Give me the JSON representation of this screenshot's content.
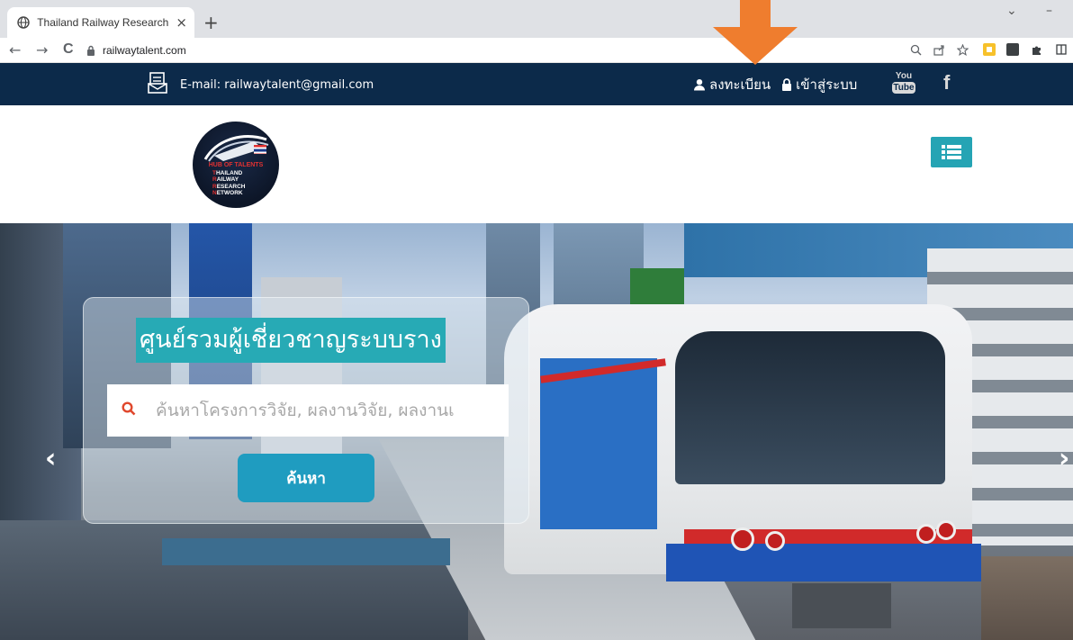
{
  "browser": {
    "tab_title": "Thailand Railway Research Netw",
    "tab_close": "×",
    "new_tab": "+",
    "url": "railwaytalent.com",
    "nav": {
      "back": "←",
      "forward": "→",
      "reload": "C"
    },
    "window": {
      "chevron": "⌄",
      "minimize": "–"
    },
    "accent": "#f7c12b"
  },
  "topbar": {
    "email": "E-mail: railwaytalent@gmail.com",
    "register": "ลงทะเบียน",
    "login": "เข้าสู่ระบบ",
    "youtube_top": "You",
    "youtube_bottom": "Tube",
    "facebook": "f",
    "bg_color": "#0c2a4a"
  },
  "logo": {
    "line1": "HUB OF TALENTS",
    "words": [
      {
        "initial": "T",
        "rest": "HAILAND"
      },
      {
        "initial": "R",
        "rest": "AILWAY"
      },
      {
        "initial": "R",
        "rest": "ESEARCH"
      },
      {
        "initial": "N",
        "rest": "ETWORK"
      }
    ]
  },
  "hero": {
    "title": "ศูนย์รวมผู้เชี่ยวชาญระบบราง",
    "search_placeholder": "ค้นหาโครงการวิจัย, ผลงานวิจัย, ผลงานเ",
    "search_button": "ค้นหา",
    "prev": "‹",
    "next": "›",
    "accent_color": "#27aab5"
  },
  "annotation": {
    "arrow_color": "#ef7d2e"
  }
}
